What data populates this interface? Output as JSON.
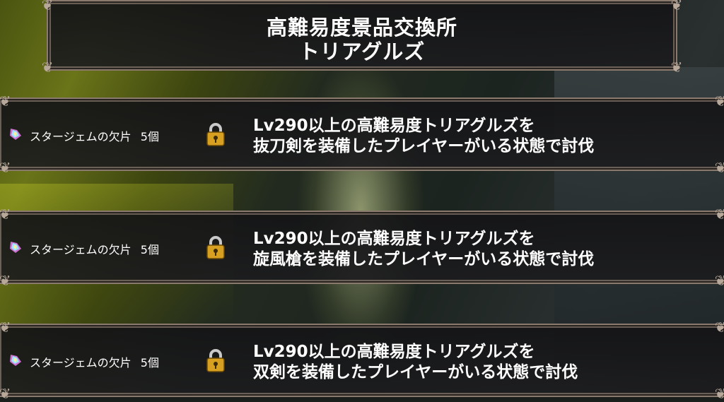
{
  "header": {
    "title_line1": "高難易度景品交換所",
    "title_line2": "トリアグルズ"
  },
  "rewards": [
    {
      "reward_label": "スタージェムの欠片",
      "quantity": "5個",
      "locked": true,
      "condition_line1": "Lv290以上の高難易度トリアグルズを",
      "condition_line2": "抜刀剣を装備したプレイヤーがいる状態で討伐"
    },
    {
      "reward_label": "スタージェムの欠片",
      "quantity": "5個",
      "locked": true,
      "condition_line1": "Lv290以上の高難易度トリアグルズを",
      "condition_line2": "旋風槍を装備したプレイヤーがいる状態で討伐"
    },
    {
      "reward_label": "スタージェムの欠片",
      "quantity": "5個",
      "locked": true,
      "condition_line1": "Lv290以上の高難易度トリアグルズを",
      "condition_line2": "双剣を装備したプレイヤーがいる状態で討伐"
    }
  ],
  "icons": {
    "gem": "star-gem-fragment-icon",
    "lock": "padlock-icon"
  },
  "colors": {
    "frame_border": "#8a7a6e",
    "lock_gold": "#d8a020",
    "text": "#ffffff"
  }
}
